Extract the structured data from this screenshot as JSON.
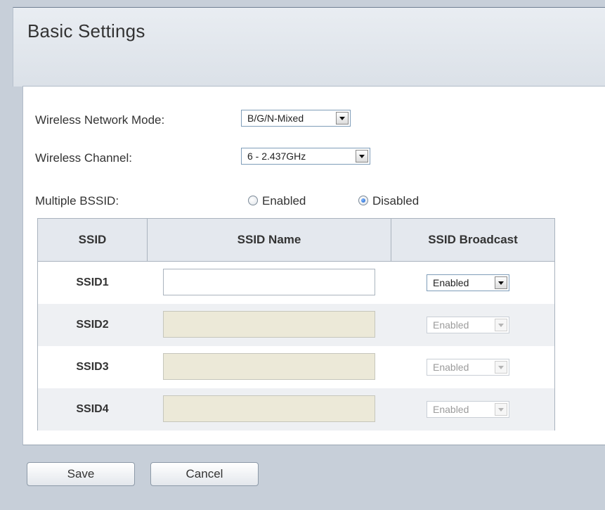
{
  "page": {
    "title": "Basic Settings"
  },
  "form": {
    "network_mode": {
      "label": "Wireless Network Mode:",
      "value": "B/G/N-Mixed"
    },
    "channel": {
      "label": "Wireless Channel:",
      "value": "6 - 2.437GHz"
    },
    "multiple_bssid": {
      "label": "Multiple BSSID:",
      "options": [
        "Enabled",
        "Disabled"
      ],
      "selected": "Disabled"
    }
  },
  "table": {
    "headers": [
      "SSID",
      "SSID Name",
      "SSID Broadcast"
    ],
    "rows": [
      {
        "ssid": "SSID1",
        "name": "",
        "broadcast": "Enabled",
        "enabled": true
      },
      {
        "ssid": "SSID2",
        "name": "",
        "broadcast": "Enabled",
        "enabled": false
      },
      {
        "ssid": "SSID3",
        "name": "",
        "broadcast": "Enabled",
        "enabled": false
      },
      {
        "ssid": "SSID4",
        "name": "",
        "broadcast": "Enabled",
        "enabled": false
      }
    ]
  },
  "buttons": {
    "save": "Save",
    "cancel": "Cancel"
  },
  "colors": {
    "background": "#c7cfd9",
    "header_bg": "#e4e8ee",
    "panel_bg": "#ffffff",
    "radio_selected": "#1d5fc7"
  }
}
